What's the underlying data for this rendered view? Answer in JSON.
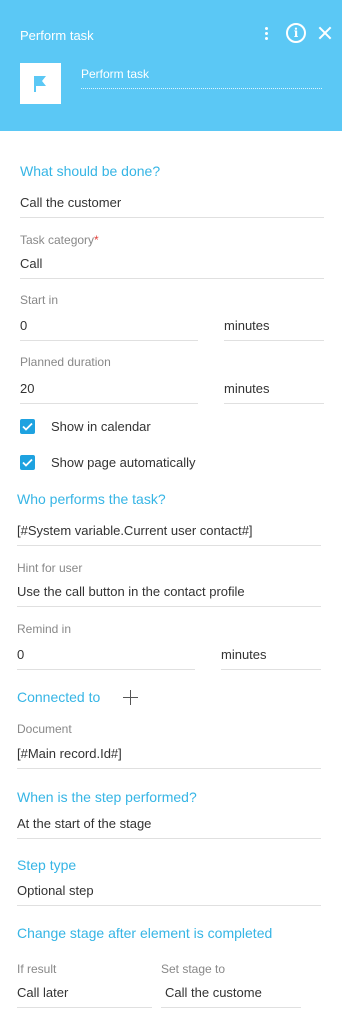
{
  "header": {
    "title": "Perform task",
    "name_value": "Perform task"
  },
  "task": {
    "section_what": "What should be done?",
    "what_value": "Call the customer",
    "category_label": "Task category",
    "category_required": "*",
    "category_value": "Call",
    "start_label": "Start in",
    "start_value": "0",
    "start_unit": "minutes",
    "duration_label": "Planned duration",
    "duration_value": "20",
    "duration_unit": "minutes",
    "show_calendar": "Show in calendar",
    "show_page": "Show page automatically"
  },
  "performer": {
    "section": "Who performs the task?",
    "value": "[#System variable.Current user contact#]",
    "hint_label": "Hint for user",
    "hint_value": "Use the call button in the contact profile",
    "remind_label": "Remind in",
    "remind_value": "0",
    "remind_unit": "minutes"
  },
  "connected": {
    "section": "Connected to",
    "document_label": "Document",
    "document_value": "[#Main record.Id#]"
  },
  "when": {
    "section": "When is the step performed?",
    "value": "At the start of the stage"
  },
  "step_type": {
    "section": "Step type",
    "value": "Optional step"
  },
  "change_stage": {
    "section": "Change stage after element is completed",
    "if_result_label": "If result",
    "if_result_value": "Call later",
    "set_stage_label": "Set stage to",
    "set_stage_value": "Call the custome"
  },
  "icons": {
    "menu": "kebab-menu-icon",
    "info": "info-icon",
    "close": "close-icon",
    "flag": "flag-icon",
    "check": "checkmark-icon",
    "plus": "plus-icon"
  },
  "colors": {
    "header_bg": "#5bc8f5",
    "section_title": "#36b5e5",
    "checkbox": "#1ea2e0",
    "required": "#e1423c"
  }
}
